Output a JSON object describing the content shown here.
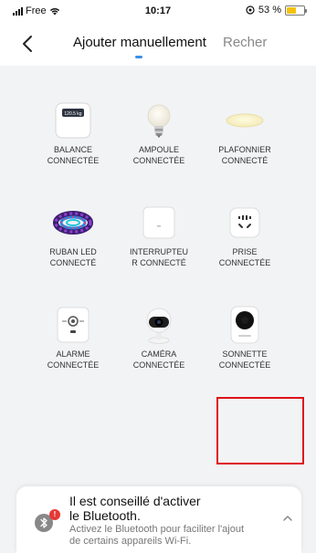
{
  "status_bar": {
    "carrier": "Free",
    "time": "10:17",
    "battery": "53 %",
    "battery_level": 0.53
  },
  "nav": {
    "title": "Ajouter manuellement",
    "other_tab": "Recher"
  },
  "devices": [
    {
      "label_line1": "BALANCE",
      "label_line2": "CONNECTÉE",
      "icon": "scale-icon",
      "display": "120.5 kg"
    },
    {
      "label_line1": "AMPOULE",
      "label_line2": "CONNECTÉE",
      "icon": "bulb-icon"
    },
    {
      "label_line1": "PLAFONNIER",
      "label_line2": "CONNECTÉ",
      "icon": "ceiling-light-icon"
    },
    {
      "label_line1": "RUBAN LED",
      "label_line2": "CONNECTÉ",
      "icon": "led-strip-icon"
    },
    {
      "label_line1": "INTERRUPTEU",
      "label_line2": "R CONNECTÉ",
      "icon": "switch-icon"
    },
    {
      "label_line1": "PRISE",
      "label_line2": "CONNECTÉE",
      "icon": "plug-icon"
    },
    {
      "label_line1": "ALARME",
      "label_line2": "CONNECTÉE",
      "icon": "alarm-icon"
    },
    {
      "label_line1": "CAMÉRA",
      "label_line2": "CONNECTÉE",
      "icon": "camera-icon"
    },
    {
      "label_line1": "SONNETTE",
      "label_line2": "CONNECTÉE",
      "icon": "doorbell-icon"
    }
  ],
  "banner": {
    "title_line1": "Il est conseillé d'activer",
    "title_line2": "le Bluetooth.",
    "text_line1": "Activez le Bluetooth pour faciliter l'ajout",
    "text_line2": "de certains appareils Wi-Fi.",
    "badge": "!"
  },
  "colors": {
    "accent": "#3a8ee6",
    "highlight": "#e0121a",
    "badge": "#e53935",
    "battery": "#f4c20d"
  }
}
